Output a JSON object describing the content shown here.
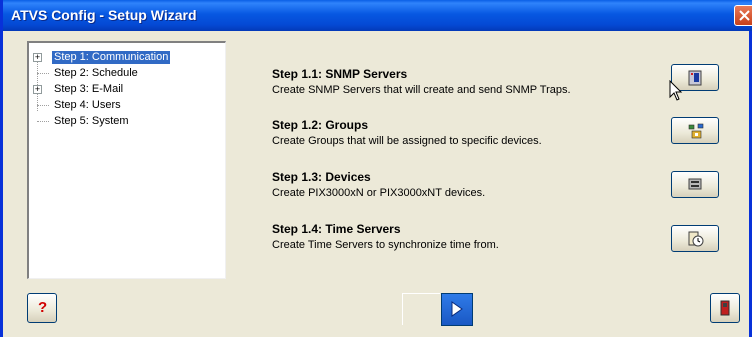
{
  "window": {
    "title": "ATVS Config - Setup Wizard"
  },
  "tree": {
    "items": [
      {
        "label": "Step 1: Communication",
        "expander": "+",
        "selected": true
      },
      {
        "label": "Step 2: Schedule",
        "expander": "",
        "selected": false
      },
      {
        "label": "Step 3: E-Mail",
        "expander": "+",
        "selected": false
      },
      {
        "label": "Step 4: Users",
        "expander": "",
        "selected": false
      },
      {
        "label": "Step 5: System",
        "expander": "",
        "selected": false
      }
    ]
  },
  "steps": [
    {
      "title": "Step 1.1: SNMP Servers",
      "description": "Create SNMP Servers that will create and send SNMP Traps.",
      "icon": "snmp-server-icon"
    },
    {
      "title": "Step 1.2: Groups",
      "description": "Create Groups that will be assigned to specific devices.",
      "icon": "groups-icon"
    },
    {
      "title": "Step 1.3: Devices",
      "description": "Create PIX3000xN or PIX3000xNT devices.",
      "icon": "device-icon"
    },
    {
      "title": "Step 1.4: Time Servers",
      "description": "Create Time Servers to synchronize time from.",
      "icon": "time-server-icon"
    }
  ],
  "footer": {
    "help_label": "?",
    "help_icon": "help-icon",
    "next_icon": "play-next-icon",
    "exit_icon": "exit-door-icon"
  },
  "colors": {
    "titlebar": "#0758e2",
    "selection": "#316ac5",
    "close": "#d84a22"
  }
}
